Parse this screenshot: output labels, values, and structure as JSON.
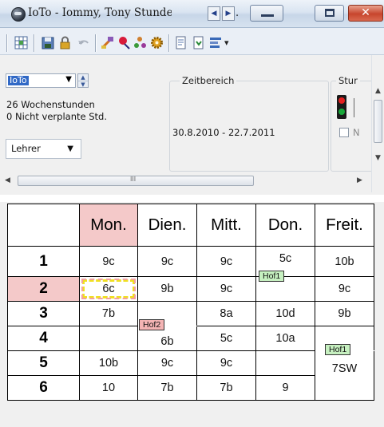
{
  "window": {
    "title": "IoTo - Iommy, Tony  Stunden",
    "title_suffix": ".",
    "prev_tab_glyph": "◀",
    "next_tab_glyph": "▶",
    "close_glyph": "✕"
  },
  "toolbar": {
    "buttons": [
      "grid-icon",
      "save-icon",
      "lock-icon",
      "undo-icon",
      "print-icon",
      "pin-icon",
      "people-icon",
      "settings-icon",
      "page-icon",
      "export-icon",
      "layout-icon"
    ],
    "more_glyph": "▾"
  },
  "info": {
    "teacher": "IoTo",
    "hours": "26 Wochenstunden",
    "unplanned": "0 Nicht verplante Std.",
    "type": "Lehrer",
    "range_label": "Zeitbereich",
    "range_value": "30.8.2010 - 22.7.2011",
    "status_label": "Stur",
    "checkbox_label": "N",
    "thumb_grip": "III"
  },
  "timetable": {
    "days": [
      "Mon.",
      "Dien.",
      "Mitt.",
      "Don.",
      "Freit."
    ],
    "rows": [
      {
        "hour": "1",
        "cells": [
          "9c",
          "9c",
          "9c",
          "5c",
          "10b"
        ]
      },
      {
        "hour": "2",
        "cells": [
          "6c",
          "9b",
          "9c",
          "",
          "9c"
        ]
      },
      {
        "hour": "3",
        "cells": [
          "7b",
          "",
          "8a",
          "10d",
          "9b"
        ]
      },
      {
        "hour": "4",
        "cells": [
          "",
          "6b",
          "5c",
          "10a",
          ""
        ]
      },
      {
        "hour": "5",
        "cells": [
          "10b",
          "9c",
          "9c",
          "",
          "7SW"
        ]
      },
      {
        "hour": "6",
        "cells": [
          "10",
          "7b",
          "7b",
          "9",
          ""
        ]
      }
    ],
    "tags": {
      "hof1_a": "Hof1",
      "hof2": "Hof2",
      "hof1_b": "Hof1"
    }
  },
  "colors": {
    "highlight": "#f4c9c9",
    "tag_green": "#c6f0c0",
    "tag_pink": "#f4b4b4"
  }
}
